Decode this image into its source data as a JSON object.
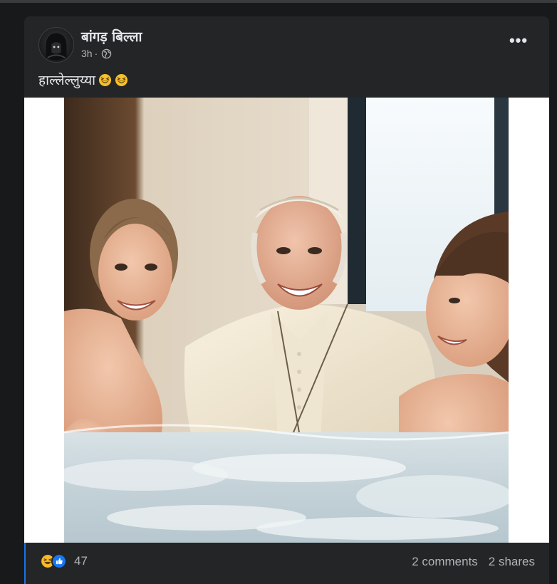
{
  "post": {
    "author_name": "बांगड़ बिल्ला",
    "timestamp": "3h",
    "separator": "·",
    "audience_icon": "globe-icon",
    "text": "हाल्लेल्लुय्या",
    "text_emojis": [
      "grinning-squinting-face",
      "grinning-squinting-face"
    ],
    "more_icon": "more-horizontal-icon",
    "more_label": "•••"
  },
  "photo": {
    "alt": "Photo of an elderly man in white vestments with a cross pendant, laughing in a bathtub with two young women"
  },
  "footer": {
    "reaction_icons": [
      "haha-icon",
      "like-icon"
    ],
    "reaction_count": "47",
    "comments": "2 comments",
    "shares": "2 shares"
  },
  "colors": {
    "page_bg": "#18191a",
    "card_bg": "#242526",
    "text_primary": "#e4e6eb",
    "text_secondary": "#b0b3b8",
    "accent": "#1b74e4",
    "like_blue": "#1877f2",
    "haha_yellow": "#f7b928"
  }
}
